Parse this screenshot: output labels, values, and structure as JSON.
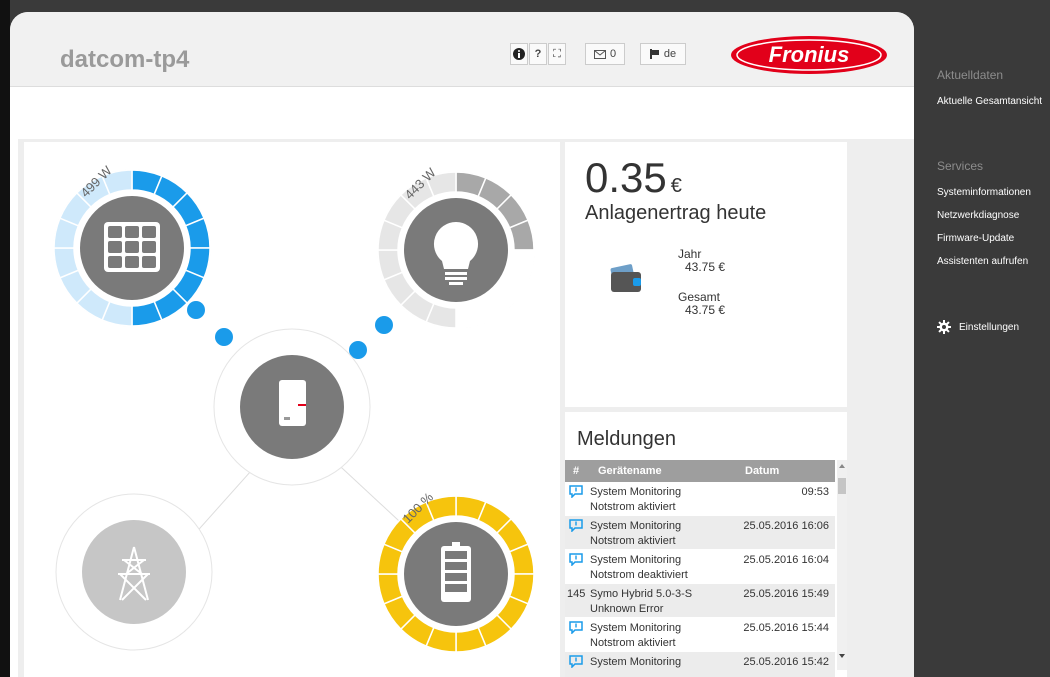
{
  "app": {
    "site_name": "datcom-tp4",
    "logo_text": "Fronius",
    "toolbar": {
      "info": "i",
      "help": "?",
      "fullscreen": "⛶",
      "messages_count": "0",
      "language": "de"
    }
  },
  "flow": {
    "pv_power": "499 W",
    "load_power": "443 W",
    "battery_soc": "100 %",
    "pv_level": 0.5,
    "load_level": 0.25,
    "battery_level": 1.0
  },
  "earnings": {
    "value": "0.35",
    "currency": "€",
    "label": "Anlagenertrag heute",
    "year_label": "Jahr",
    "year_value": "43.75 €",
    "total_label": "Gesamt",
    "total_value": "43.75 €"
  },
  "messages": {
    "title": "Meldungen",
    "columns": {
      "num": "#",
      "device": "Gerätename",
      "date": "Datum"
    },
    "rows": [
      {
        "num": "",
        "device": "System Monitoring",
        "text": "Notstrom aktiviert",
        "date": "09:53"
      },
      {
        "num": "",
        "device": "System Monitoring",
        "text": "Notstrom aktiviert",
        "date": "25.05.2016 16:06"
      },
      {
        "num": "",
        "device": "System Monitoring",
        "text": "Notstrom deaktiviert",
        "date": "25.05.2016 16:04"
      },
      {
        "num": "145",
        "device": "Symo Hybrid 5.0-3-S",
        "text": "Unknown Error",
        "date": "25.05.2016 15:49"
      },
      {
        "num": "",
        "device": "System Monitoring",
        "text": "Notstrom aktiviert",
        "date": "25.05.2016 15:44"
      },
      {
        "num": "",
        "device": "System Monitoring",
        "text": "",
        "date": "25.05.2016 15:42"
      }
    ]
  },
  "sidebar": {
    "section1": "Aktuelldaten",
    "current_overview": "Aktuelle Gesamtansicht",
    "section2": "Services",
    "items": [
      "Systeminformationen",
      "Netzwerkdiagnose",
      "Firmware-Update",
      "Assistenten aufrufen"
    ],
    "settings": "Einstellungen"
  },
  "colors": {
    "blue": "#1a9bea",
    "light_blue": "#cfe9fb",
    "yellow": "#f6c40d",
    "gray": "#7b7b7b",
    "brand_red": "#e2001a",
    "sidebar_bg": "#3a3a3a"
  }
}
